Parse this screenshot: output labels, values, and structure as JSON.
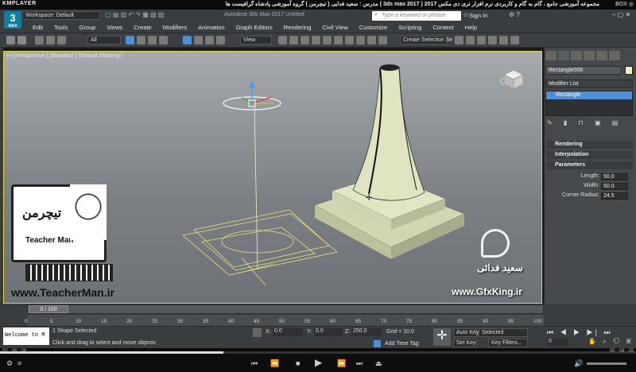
{
  "player": {
    "name": "KMPLAYER",
    "title": "مجموعه آموزشی جامع ، گام به گام و کاربردی نرم افزار تری دی مکس 2017 ( 3ds max 2017 )   مدرس : سعید فدایی ( تیچرمن ) گروه آموزشی پادشاه گرافیست ها",
    "corner": "BOX ◎",
    "time_left": "00 : 06 : 06",
    "time_right": "00 : 08 : 25"
  },
  "app": {
    "logo": "3",
    "logo_sub": "MAX",
    "workspace": "Workspace: Default",
    "doc_title": "Autodesk 3ds Max 2017    Untitled",
    "search_placeholder": "Type a keyword or phrase",
    "sign_in": "Sign In",
    "menus": [
      "Edit",
      "Tools",
      "Group",
      "Views",
      "Create",
      "Modifiers",
      "Animation",
      "Graph Editors",
      "Rendering",
      "Civil View",
      "Customize",
      "Scripting",
      "Content",
      "Help"
    ],
    "filter": "All",
    "ref_coord": "View",
    "selection_set": "Create Selection Se"
  },
  "viewport": {
    "label": "[+] [Perspective ] [Standard ] [Default Shading ]"
  },
  "panel": {
    "object_name": "Rectangle006",
    "modifier_list": "Modifier List",
    "stack_item": "Rectangle",
    "rollouts": [
      "Rendering",
      "Interpolation",
      "Parameters"
    ],
    "params": [
      {
        "label": "Length:",
        "value": "50.0"
      },
      {
        "label": "Width:",
        "value": "50.0"
      },
      {
        "label": "Corner Radius:",
        "value": "24.5"
      }
    ]
  },
  "timeline": {
    "frame_label": "0 / 100",
    "ticks": [
      "0",
      "5",
      "10",
      "15",
      "20",
      "25",
      "30",
      "35",
      "40",
      "45",
      "50",
      "55",
      "60",
      "65",
      "70",
      "75",
      "80",
      "85",
      "90",
      "95",
      "100"
    ],
    "progress": 0.351
  },
  "status": {
    "welcome": "Welcome to M",
    "selected": "1 Shape Selected",
    "prompt": "Click and drag to select and move objects",
    "x_label": "X:",
    "x": "0.0",
    "y_label": "Y:",
    "y": "0.0",
    "z_label": "Z:",
    "z": "250.0",
    "grid": "Grid = 10.0",
    "add_time_tag": "Add Time Tag",
    "auto_key": "Auto Key",
    "selected_dd": "Selected",
    "set_key": "Set Key",
    "key_filters": "Key Filters...",
    "frame": "0"
  },
  "watermark": {
    "left_title": "تیچرمن",
    "left_sub": "Teacher Man",
    "left_url": "www.TeacherMan.ir",
    "right_name": "سعید فدائی",
    "right_url": "www.GfxKing.ir"
  },
  "colors": {
    "accent": "#0e7fa3",
    "viewport_border": "#e6d23a",
    "object": "#e0e4c0",
    "wire": "#e8e07a",
    "selection_blue": "#4f8fd8"
  }
}
